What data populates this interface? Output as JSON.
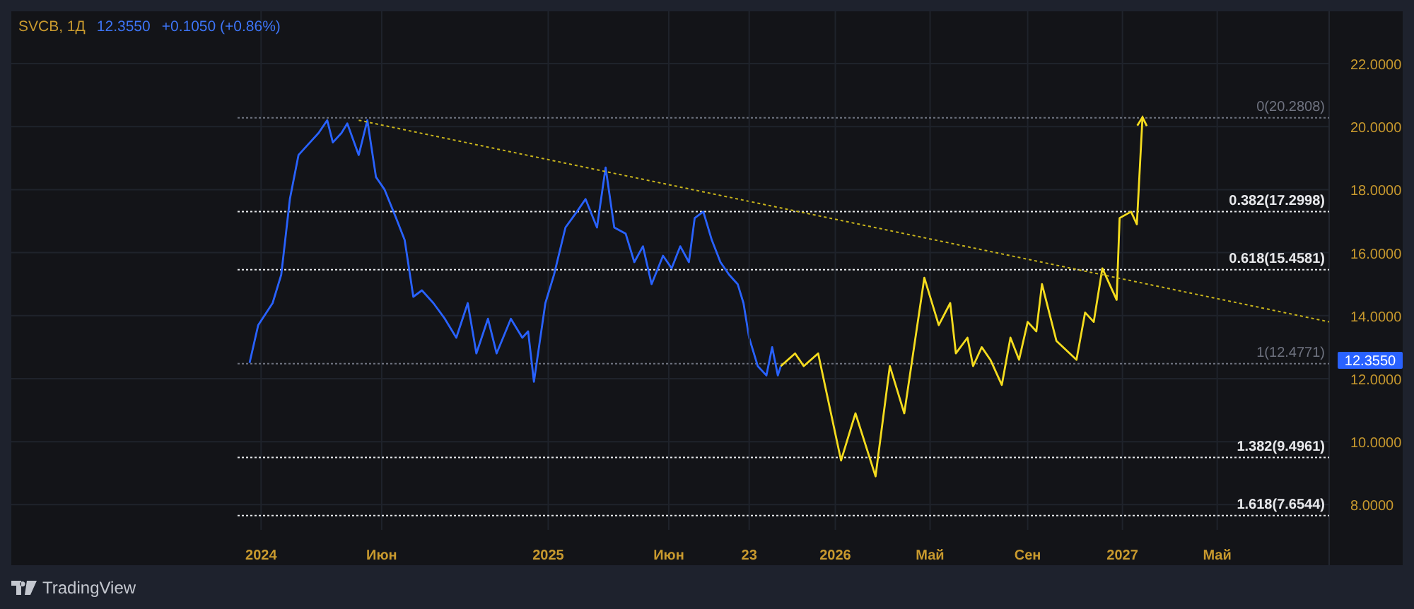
{
  "header": {
    "symbol": "SVCB, 1Д",
    "price": "12.3550",
    "change": "+0.1050 (+0.86%)"
  },
  "chart": {
    "chart_data": {
      "type": "line",
      "x": [
        2023.96,
        2023.99,
        2024.04,
        2024.07,
        2024.1,
        2024.13,
        2024.17,
        2024.2,
        2024.23,
        2024.25,
        2024.28,
        2024.3,
        2024.34,
        2024.37,
        2024.4,
        2024.43,
        2024.47,
        2024.5,
        2024.53,
        2024.56,
        2024.6,
        2024.64,
        2024.68,
        2024.72,
        2024.75,
        2024.79,
        2024.82,
        2024.87,
        2024.91,
        2024.93,
        2024.95,
        2024.99,
        2025.02,
        2025.06,
        2025.1,
        2025.13,
        2025.17,
        2025.2,
        2025.23,
        2025.27,
        2025.3,
        2025.33,
        2025.36,
        2025.4,
        2025.43,
        2025.46,
        2025.49,
        2025.51,
        2025.54,
        2025.57,
        2025.6,
        2025.63,
        2025.66,
        2025.68,
        2025.7,
        2025.73,
        2025.76,
        2025.78,
        2025.8,
        2025.81,
        2025.86,
        2025.89,
        2025.94,
        2026.02,
        2026.07,
        2026.14,
        2026.19,
        2026.24,
        2026.31,
        2026.36,
        2026.4,
        2026.42,
        2026.46,
        2026.48,
        2026.51,
        2026.54,
        2026.58,
        2026.61,
        2026.64,
        2026.67,
        2026.7,
        2026.72,
        2026.77,
        2026.84,
        2026.87,
        2026.9,
        2026.93,
        2026.98,
        2026.99,
        2027.03,
        2027.05,
        2027.07,
        2027.72
      ],
      "series": [
        {
          "color": "#2962ff",
          "values": [
            12.5,
            13.7,
            14.4,
            15.3,
            17.7,
            19.1,
            19.5,
            19.8,
            20.2,
            19.5,
            19.8,
            20.1,
            19.1,
            20.2,
            18.4,
            18.0,
            17.1,
            16.4,
            14.6,
            14.8,
            14.4,
            13.9,
            13.3,
            14.4,
            12.8,
            13.9,
            12.8,
            13.9,
            13.3,
            13.5,
            11.9,
            14.4,
            15.3,
            16.8,
            17.3,
            17.7,
            16.8,
            18.7,
            16.8,
            16.6,
            15.7,
            16.2,
            15.0,
            15.9,
            15.5,
            16.2,
            15.7,
            17.1,
            17.3,
            16.4,
            15.7,
            15.3,
            15.0,
            14.4,
            13.3,
            12.4,
            12.1,
            13.0,
            12.1,
            12.4,
            null,
            null,
            null,
            null,
            null,
            null,
            null,
            null,
            null,
            null,
            null,
            null,
            null,
            null,
            null,
            null,
            null,
            null,
            null,
            null,
            null,
            null,
            null,
            null,
            null,
            null,
            null,
            null,
            null,
            null,
            null,
            null,
            null
          ]
        },
        {
          "color": "#f5dc1e",
          "values": [
            null,
            null,
            null,
            null,
            null,
            null,
            null,
            null,
            null,
            null,
            null,
            null,
            null,
            null,
            null,
            null,
            null,
            null,
            null,
            null,
            null,
            null,
            null,
            null,
            null,
            null,
            null,
            null,
            null,
            null,
            null,
            null,
            null,
            null,
            null,
            null,
            null,
            null,
            null,
            null,
            null,
            null,
            null,
            null,
            null,
            null,
            null,
            null,
            null,
            null,
            null,
            null,
            null,
            null,
            null,
            null,
            null,
            null,
            null,
            12.4,
            12.8,
            12.4,
            12.8,
            9.4,
            10.9,
            8.9,
            12.4,
            10.9,
            15.2,
            13.7,
            14.4,
            12.8,
            13.3,
            12.4,
            13.0,
            12.6,
            11.8,
            13.3,
            12.6,
            13.8,
            13.5,
            15.0,
            13.2,
            12.6,
            14.1,
            13.8,
            15.5,
            14.5,
            17.1,
            17.3,
            16.9,
            20.3,
            null
          ]
        },
        {
          "color": "#c8b41c",
          "line_style": "dashed",
          "values": [
            null,
            null,
            null,
            null,
            null,
            null,
            null,
            null,
            null,
            null,
            null,
            null,
            20.2,
            null,
            null,
            null,
            null,
            null,
            null,
            null,
            null,
            null,
            null,
            null,
            null,
            null,
            null,
            null,
            null,
            null,
            null,
            null,
            null,
            null,
            null,
            null,
            null,
            null,
            null,
            null,
            null,
            null,
            null,
            null,
            null,
            null,
            null,
            null,
            null,
            null,
            null,
            null,
            null,
            null,
            null,
            null,
            null,
            null,
            null,
            null,
            null,
            null,
            null,
            null,
            null,
            null,
            null,
            null,
            null,
            null,
            null,
            null,
            null,
            null,
            null,
            null,
            null,
            null,
            null,
            null,
            null,
            null,
            null,
            null,
            null,
            null,
            null,
            null,
            null,
            null,
            null,
            null,
            13.8
          ]
        }
      ],
      "grid": true,
      "xlim": [
        2023.13,
        2027.72
      ],
      "ylim": [
        7.2,
        23.66
      ],
      "xticks": [
        {
          "value": 2024,
          "label": "2024"
        },
        {
          "value": 2024.42,
          "label": "Июн"
        },
        {
          "value": 2025,
          "label": "2025"
        },
        {
          "value": 2025.42,
          "label": "Июн"
        },
        {
          "value": 2026,
          "label": "2026"
        },
        {
          "value": 2026.33,
          "label": "Май"
        },
        {
          "value": 2026.67,
          "label": "Сен"
        },
        {
          "value": 2027,
          "label": "2027"
        },
        {
          "value": 2027.33,
          "label": "Май"
        }
      ],
      "yticks": [
        {
          "value": 8,
          "label": "8.0000"
        },
        {
          "value": 10,
          "label": "10.0000"
        },
        {
          "value": 12,
          "label": "12.0000"
        },
        {
          "value": 14,
          "label": "14.0000"
        },
        {
          "value": 16,
          "label": "16.0000"
        },
        {
          "value": 18,
          "label": "18.0000"
        },
        {
          "value": 20,
          "label": "20.0000"
        },
        {
          "value": 22,
          "label": "22.0000"
        }
      ],
      "ref_lines": [
        {
          "axis": "y",
          "value": 20.2808,
          "label": "0(20.2808)",
          "color": "#6f7380"
        },
        {
          "axis": "y",
          "value": 17.2998,
          "label": "0.382(17.2998)",
          "color": "#e8e9ec"
        },
        {
          "axis": "y",
          "value": 15.4581,
          "label": "0.618(15.4581)",
          "color": "#e8e9ec"
        },
        {
          "axis": "y",
          "value": 12.4771,
          "label": "1(12.4771)",
          "color": "#6f7380"
        },
        {
          "axis": "y",
          "value": 9.4961,
          "label": "1.382(9.4961)",
          "color": "#e8e9ec"
        },
        {
          "axis": "y",
          "value": 7.6544,
          "label": "1.618(7.6544)",
          "color": "#e8e9ec"
        }
      ]
    },
    "day_label": {
      "text": "23"
    },
    "price_tag": {
      "text": "12.3550"
    }
  },
  "footer": {
    "brand": "TradingView"
  }
}
